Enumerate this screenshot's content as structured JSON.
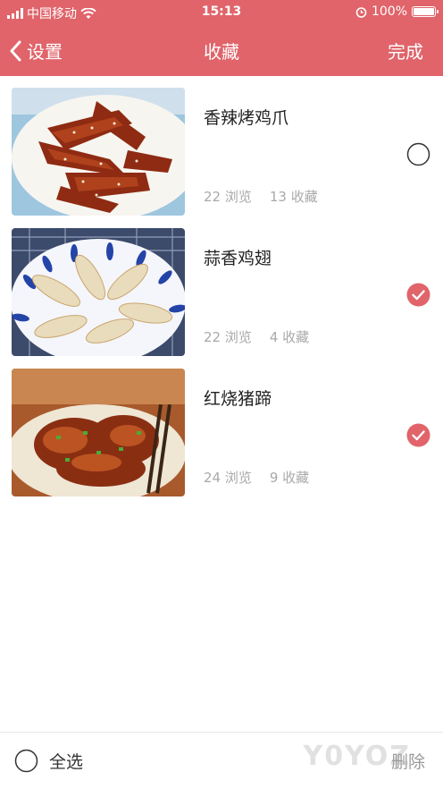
{
  "status_bar": {
    "carrier": "中国移动",
    "time": "15:13",
    "battery_percent": "100%"
  },
  "nav": {
    "back_label": "设置",
    "title": "收藏",
    "done_label": "完成"
  },
  "items": [
    {
      "name": "香辣烤鸡爪",
      "views": "22 浏览",
      "favorites": "13 收藏",
      "selected": false
    },
    {
      "name": "蒜香鸡翅",
      "views": "22 浏览",
      "favorites": "4 收藏",
      "selected": true
    },
    {
      "name": "红烧猪蹄",
      "views": "24 浏览",
      "favorites": "9 收藏",
      "selected": true
    }
  ],
  "footer": {
    "select_all_label": "全选",
    "delete_label": "删除"
  },
  "watermark": "Y0YOZ",
  "colors": {
    "accent": "#e0646a",
    "muted_text": "#a9a9a9"
  }
}
